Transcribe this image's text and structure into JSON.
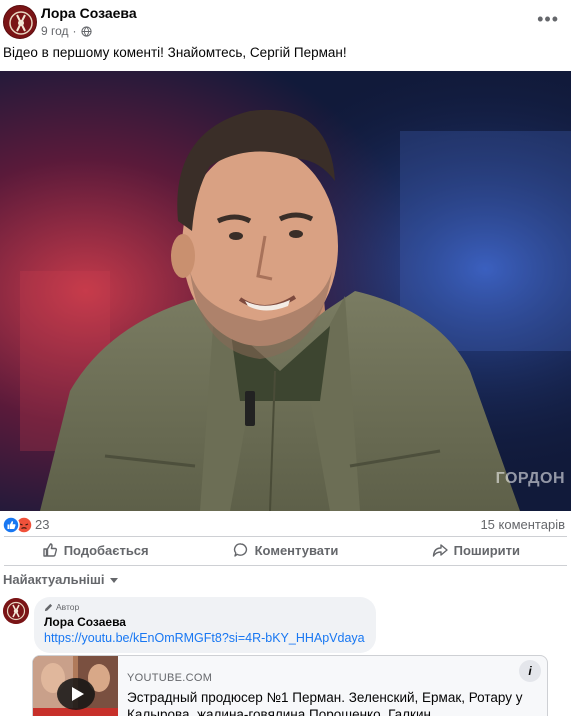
{
  "post": {
    "author": "Лора Созаева",
    "time": "9 год",
    "separator": "·",
    "text": "Відео в першому коменті! Знайомтесь, Сергій Перман!",
    "image_watermark": "ГОРДОН"
  },
  "stats": {
    "reactions_count": "23",
    "comments_count": "15 коментарів",
    "reaction_icons": [
      "like-icon",
      "angry-icon"
    ]
  },
  "actions": {
    "like": "Подобається",
    "comment": "Коментувати",
    "share": "Поширити"
  },
  "comments": {
    "sort_label": "Найактуальніші",
    "first": {
      "badge": "Автор",
      "author": "Лора Созаева",
      "link": "https://youtu.be/kEnOmRMGFt8?si=4R-bKY_HHApVdaya"
    }
  },
  "link_preview": {
    "domain": "YOUTUBE.COM",
    "title": "Эстрадный продюсер №1 Перман. Зеленский, Ермак, Ротару у Калырова, жалина-говялина Порошенко, Галкин"
  },
  "colors": {
    "accent": "#1877f2",
    "secondary_text": "#65676b",
    "bubble_bg": "#f0f2f5",
    "avatar_bg": "#7a1416"
  }
}
